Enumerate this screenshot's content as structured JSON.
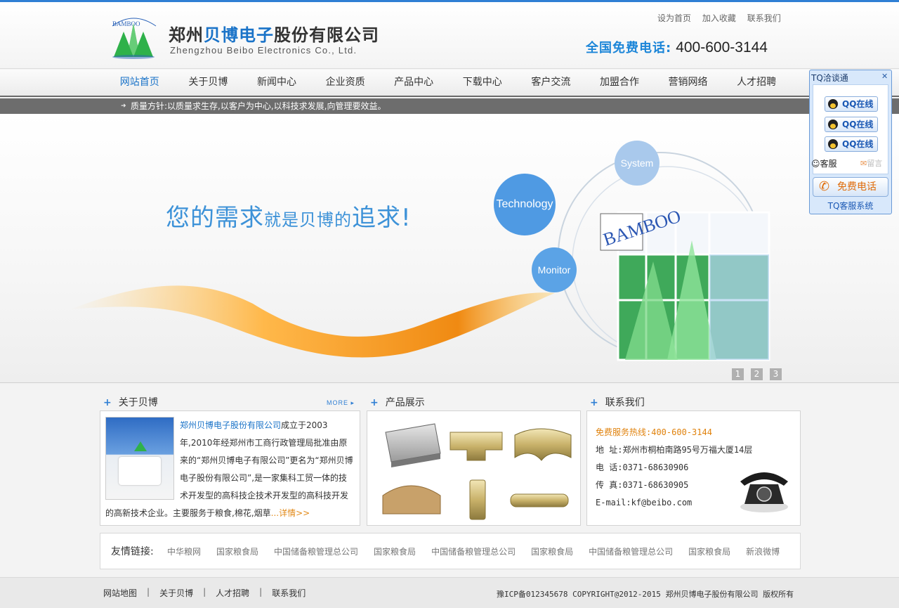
{
  "header": {
    "logo_text": "BAMBOO",
    "company_cn_prefix": "郑州",
    "company_cn_blue": "贝博电子",
    "company_cn_suffix": "股份有限公司",
    "company_en": "Zhengzhou Beibo Electronics Co., Ltd.",
    "top_links": [
      "设为首页",
      "加入收藏",
      "联系我们"
    ],
    "hotline_label": "全国免费电话:",
    "hotline_number": "400-600-3144"
  },
  "nav": {
    "items": [
      "网站首页",
      "关于贝博",
      "新闻中心",
      "企业资质",
      "产品中心",
      "下载中心",
      "客户交流",
      "加盟合作",
      "营销网络",
      "人才招聘"
    ],
    "active": "网站首页"
  },
  "notice": {
    "text": "质量方针:以质量求生存,以客户为中心,以科技求发展,向管理要效益。"
  },
  "banner": {
    "slogan_part1": "您的需求",
    "slogan_part2": "就是贝博的",
    "slogan_part3": "追求!",
    "bubbles": [
      "Technology",
      "System",
      "Monitor"
    ],
    "cube_text": "BAMBOO",
    "slides": [
      "1",
      "2",
      "3"
    ]
  },
  "about": {
    "title": "关于贝博",
    "more": "MORE",
    "company_link": "郑州贝博电子股份有限公司",
    "text": "成立于2003年,2010年经郑州市工商行政管理局批准由原来的“郑州贝博电子有限公司”更名为“郑州贝博电子股份有限公司”,是一家集科工贸一体的技术开发型的高科技企技术开发型的高科技开发的高新技术企业。主要服务于粮食,棉花,烟草",
    "ellipsis": "...",
    "detail": "详情>>"
  },
  "products": {
    "title": "产品展示"
  },
  "contact": {
    "title": "联系我们",
    "hotline": "免费服务热线:400-600-3144",
    "address": "地  址:郑州市桐柏南路95号万福大厦14层",
    "phone": "电  话:0371-68630906",
    "fax": "传  真:0371-68630905",
    "email": "E-mail:kf@beibo.com"
  },
  "friends": {
    "label": "友情链接:",
    "links": [
      "中华粮网",
      "国家粮食局",
      "中国储备粮管理总公司",
      "国家粮食局",
      "中国储备粮管理总公司",
      "国家粮食局",
      "中国储备粮管理总公司",
      "国家粮食局",
      "新浪微博"
    ]
  },
  "footer": {
    "links": [
      "网站地图",
      "关于贝博",
      "人才招聘",
      "联系我们"
    ],
    "separator": "|",
    "copyright": "豫ICP备012345678  COPYRIGHT@2012-2015 郑州贝博电子股份有限公司 版权所有"
  },
  "tq": {
    "title": "TQ洽谈通",
    "close": "✕",
    "qq_buttons": [
      "QQ在线",
      "QQ在线",
      "QQ在线"
    ],
    "kefu": "客服",
    "liuyan": "留言",
    "free_call": "免费电话",
    "footer": "TQ客服系统"
  },
  "colors": {
    "accent": "#1a73c8",
    "orange": "#e0820d",
    "notice_bar": "#6d6d6d"
  }
}
